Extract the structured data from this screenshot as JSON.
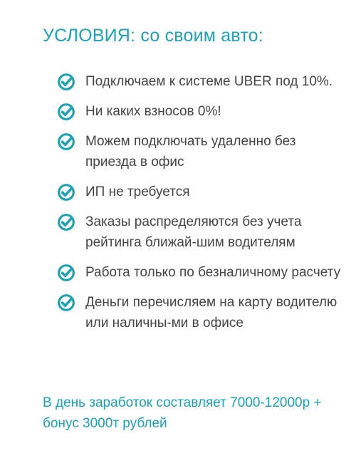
{
  "title": "УСЛОВИЯ: со своим авто:",
  "conditions": [
    {
      "text": "Подключаем к системе UBER под 10%.",
      "icon": "check-circle-icon"
    },
    {
      "text": "Ни каких взносов 0%!",
      "icon": "check-circle-icon"
    },
    {
      "text": "Можем подключать удаленно без приезда в офис",
      "icon": "check-circle-icon"
    },
    {
      "text": "ИП не требуется",
      "icon": "check-circle-icon"
    },
    {
      "text": "Заказы распределяются без учета рейтинга ближай-шим водителям",
      "icon": "check-circle-icon"
    },
    {
      "text": "Работа только по безналичному расчету",
      "icon": "check-circle-icon"
    },
    {
      "text": "Деньги перечисляем на карту водителю или наличны-ми в офисе",
      "icon": "check-circle-icon"
    }
  ],
  "footer": {
    "earnings": "В день заработок составляет 7000-12000р + бонус 3000т рублей"
  },
  "colors": {
    "accent": "#1ba3b5",
    "text": "#444444",
    "background": "#ffffff"
  }
}
